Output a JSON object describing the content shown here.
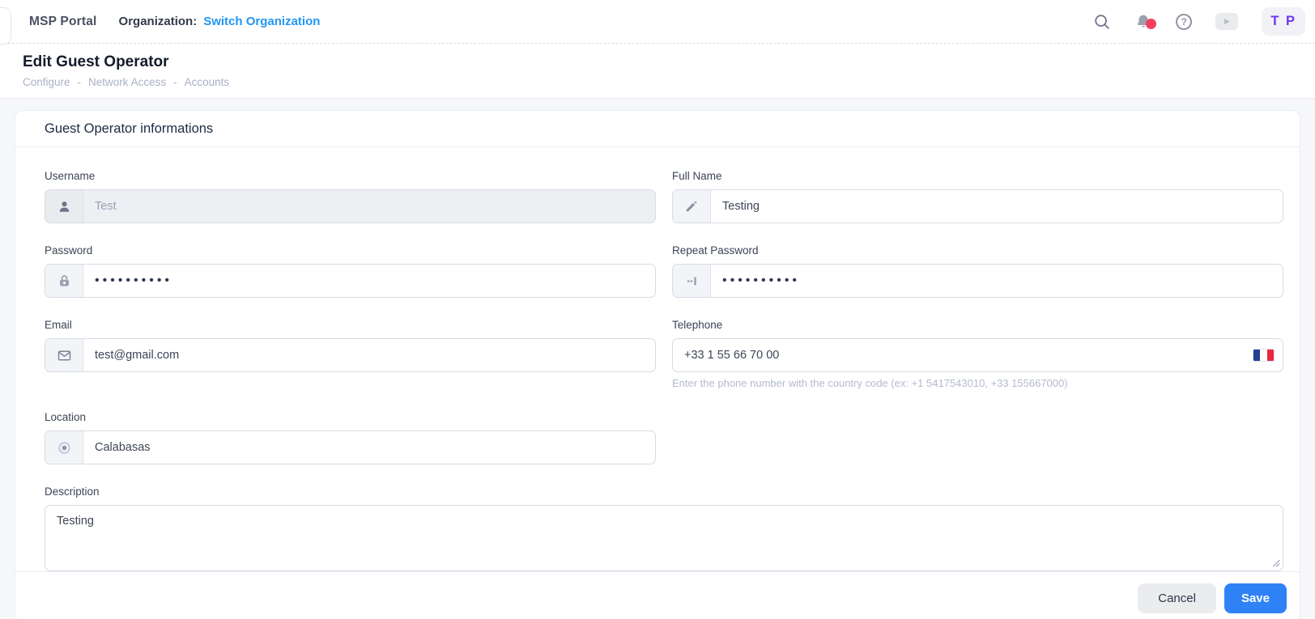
{
  "topbar": {
    "brand": "MSP Portal",
    "org_label": "Organization:",
    "org_link": "Switch Organization",
    "help_glyph": "?",
    "play_glyph": "▶",
    "avatar_initials": "T P"
  },
  "page": {
    "title": "Edit Guest Operator",
    "breadcrumb": [
      "Configure",
      "Network Access",
      "Accounts"
    ],
    "separator": "-"
  },
  "card": {
    "title": "Guest Operator informations"
  },
  "form": {
    "username": {
      "label": "Username",
      "value": "Test",
      "disabled": true
    },
    "full_name": {
      "label": "Full Name",
      "value": "Testing"
    },
    "password": {
      "label": "Password",
      "value": "••••••••••"
    },
    "repeat_password": {
      "label": "Repeat Password",
      "value": "••••••••••"
    },
    "email": {
      "label": "Email",
      "value": "test@gmail.com"
    },
    "telephone": {
      "label": "Telephone",
      "value": "+33 1 55 66 70 00",
      "helper": "Enter the phone number with the country code (ex: +1 5417543010, +33 155667000)",
      "flag": "france"
    },
    "location": {
      "label": "Location",
      "value": "Calabasas"
    },
    "description": {
      "label": "Description",
      "value": "Testing"
    }
  },
  "footer": {
    "cancel": "Cancel",
    "save": "Save"
  },
  "icons": {
    "search-icon": "magnifying glass",
    "notifications-icon": "bell with red badge",
    "help-icon": "question mark in circle",
    "play-icon": "play triangle chip",
    "user-icon": "person silhouette",
    "edit-icon": "pencil",
    "lock-icon": "padlock",
    "password-icon": "dots with cursor bar",
    "mail-icon": "envelope",
    "location-icon": "dot with ring",
    "france-flag-icon": "blue white red vertical stripes"
  },
  "colors": {
    "link_blue": "#2196f3",
    "save_blue": "#2e82f6",
    "badge_red": "#f43f5e",
    "avatar_purple": "#6e36f2",
    "flag_blue": "#243f94",
    "flag_red": "#ea2839"
  }
}
